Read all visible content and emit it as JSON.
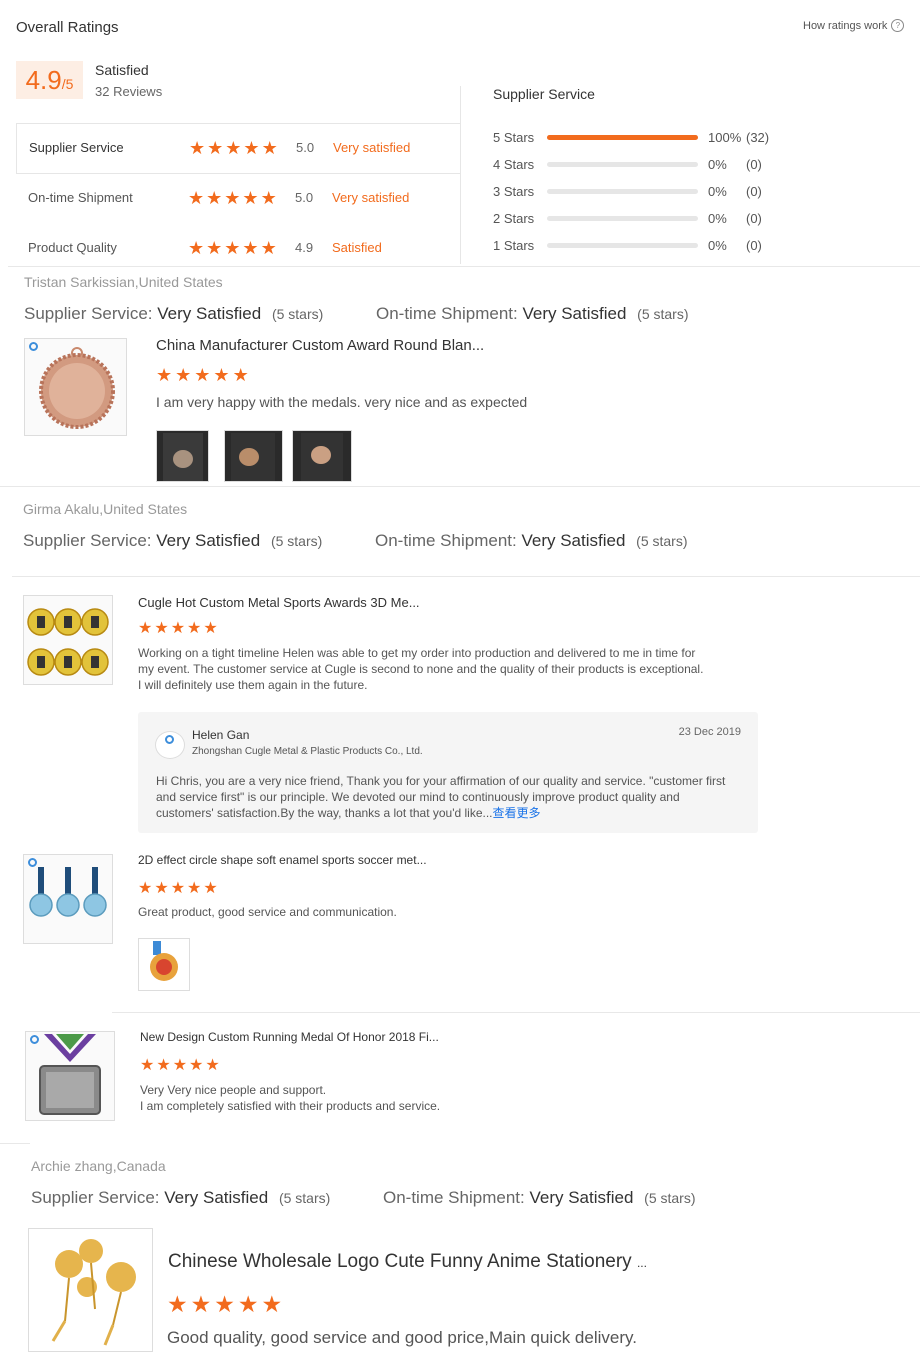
{
  "header": {
    "title": "Overall Ratings",
    "how_link": "How ratings work",
    "score": "4.9",
    "score_suffix": "/5",
    "verdict": "Satisfied",
    "reviews": "32 Reviews"
  },
  "criteria": [
    {
      "label": "Supplier Service",
      "score": "5.0",
      "verdict": "Very satisfied",
      "stars": 5
    },
    {
      "label": "On-time Shipment",
      "score": "5.0",
      "verdict": "Very satisfied",
      "stars": 5
    },
    {
      "label": "Product Quality",
      "score": "4.9",
      "verdict": "Satisfied",
      "stars": 5
    }
  ],
  "breakdown": {
    "title": "Supplier Service",
    "rows": [
      {
        "label": "5 Stars",
        "pct": "100%",
        "count": "(32)",
        "fill": 1.0
      },
      {
        "label": "4 Stars",
        "pct": "0%",
        "count": "(0)",
        "fill": 0
      },
      {
        "label": "3 Stars",
        "pct": "0%",
        "count": "(0)",
        "fill": 0
      },
      {
        "label": "2 Stars",
        "pct": "0%",
        "count": "(0)",
        "fill": 0
      },
      {
        "label": "1 Stars",
        "pct": "0%",
        "count": "(0)",
        "fill": 0
      }
    ]
  },
  "labels": {
    "supplier_service": "Supplier Service:",
    "ontime_shipment": "On-time Shipment:",
    "very_satisfied": "Very Satisfied",
    "five_stars": "(5 stars)"
  },
  "reviews": [
    {
      "reviewer": "Tristan Sarkissian,United States",
      "product": "China Manufacturer Custom Award Round Blan...",
      "text": "I am very happy with the medals. very nice and as expected"
    },
    {
      "reviewer": "Girma Akalu,United States",
      "product": "Cugle Hot Custom Metal Sports Awards 3D Me...",
      "text_lines": [
        "Working on a tight timeline Helen was able to get my order into production and delivered to me in time for",
        "my event. The customer service at Cugle is second to none and the quality of their products is exceptional.",
        "I will definitely use them again in the future."
      ],
      "reply": {
        "name": "Helen Gan",
        "company": "Zhongshan Cugle Metal & Plastic Products Co., Ltd.",
        "date": "23 Dec 2019",
        "lines": [
          "Hi Chris, you are a very nice friend, Thank you for your affirmation of our quality and service. \"customer first",
          "and service first\" is our principle. We devoted our mind to continuously improve product quality and",
          "customers' satisfaction.By the way, thanks a lot that you'd like..."
        ],
        "more": "查看更多"
      },
      "product2": "2D effect circle shape soft enamel sports soccer met...",
      "text2": "Great product, good service and communication.",
      "product3": "New Design Custom Running Medal Of Honor 2018 Fi...",
      "text3_lines": [
        "Very Very nice people and support.",
        "I am completely satisfied with their products and service."
      ]
    },
    {
      "reviewer": "Archie zhang,Canada",
      "product": "Chinese Wholesale Logo Cute Funny Anime Stationery",
      "product_ellipsis": "...",
      "text": "Good quality, good service and good price,Main quick delivery."
    }
  ],
  "colors": {
    "accent": "#f26b1d",
    "bar_bg": "#e6e6e6",
    "score_bg": "#fdeee4"
  },
  "icons": [
    "star-icon",
    "help-circle-icon",
    "logo-badge-icon"
  ]
}
